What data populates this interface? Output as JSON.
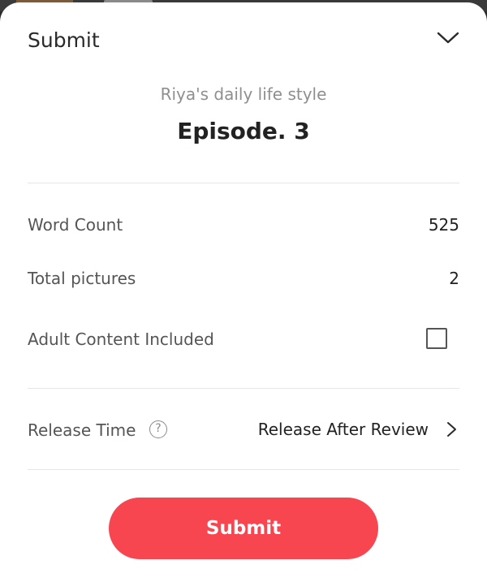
{
  "header": {
    "title": "Submit",
    "collapse_icon": "chevron-down-icon"
  },
  "episode": {
    "story_name": "Riya's daily life style",
    "title": "Episode. 3"
  },
  "details": {
    "word_count_label": "Word Count",
    "word_count_value": "525",
    "pictures_label": "Total pictures",
    "pictures_value": "2",
    "adult_label": "Adult Content Included",
    "adult_checked": false
  },
  "release": {
    "label": "Release Time",
    "help_icon_glyph": "?",
    "value": "Release After Review",
    "chevron_icon": "chevron-right-icon"
  },
  "actions": {
    "submit_label": "Submit"
  },
  "colors": {
    "accent": "#f74650",
    "text_primary": "#222222",
    "text_secondary": "#8f8f8f",
    "divider": "#e6e6e6"
  }
}
